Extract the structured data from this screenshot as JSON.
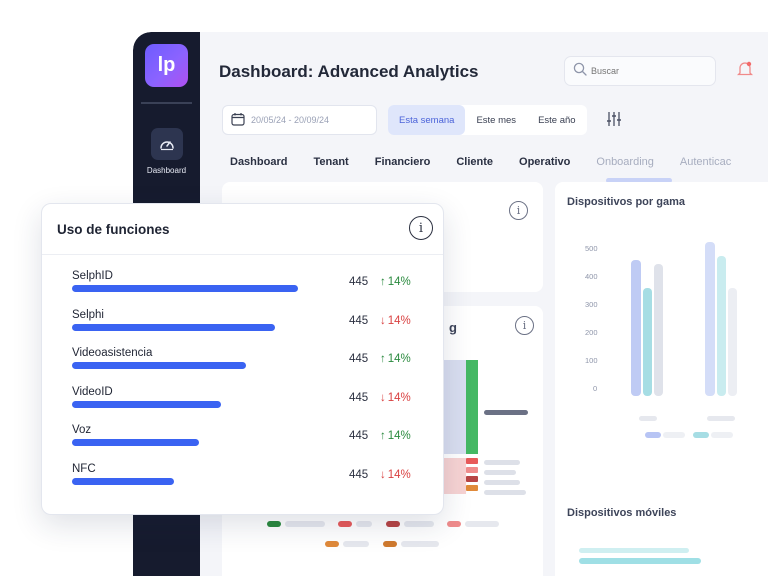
{
  "app": {
    "logo_text": "lp",
    "sidebar": {
      "dashboard_label": "Dashboard"
    },
    "title": "Dashboard: Advanced Analytics",
    "search": {
      "placeholder": "Buscar"
    },
    "date_range": "20/05/24 - 20/09/24",
    "periods": [
      "Esta semana",
      "Este mes",
      "Este año"
    ],
    "active_period": "Esta semana",
    "tabs": [
      "Dashboard",
      "Tenant",
      "Financiero",
      "Cliente",
      "Operativo",
      "Onboarding",
      "Autenticac"
    ],
    "cards": {
      "gama_title": "Dispositivos por gama",
      "gama_yticks": [
        "500",
        "400",
        "300",
        "200",
        "100",
        "0"
      ],
      "moviles_title": "Dispositivos móviles",
      "card2_title_fragment": "g"
    },
    "colors": {
      "accent": "#3a63f2",
      "sidebar": "#161b2e",
      "up": "#2a8a3e",
      "down": "#d94141"
    }
  },
  "overlay": {
    "title": "Uso de funciones",
    "features": [
      {
        "name": "SelphID",
        "count": "445",
        "trend": "up",
        "change": "14%",
        "bar_fraction": 1.0
      },
      {
        "name": "Selphi",
        "count": "445",
        "trend": "down",
        "change": "14%",
        "bar_fraction": 0.9
      },
      {
        "name": "Videoasistencia",
        "count": "445",
        "trend": "up",
        "change": "14%",
        "bar_fraction": 0.77
      },
      {
        "name": "VideoID",
        "count": "445",
        "trend": "down",
        "change": "14%",
        "bar_fraction": 0.66
      },
      {
        "name": "Voz",
        "count": "445",
        "trend": "up",
        "change": "14%",
        "bar_fraction": 0.56
      },
      {
        "name": "NFC",
        "count": "445",
        "trend": "down",
        "change": "14%",
        "bar_fraction": 0.45
      }
    ]
  }
}
